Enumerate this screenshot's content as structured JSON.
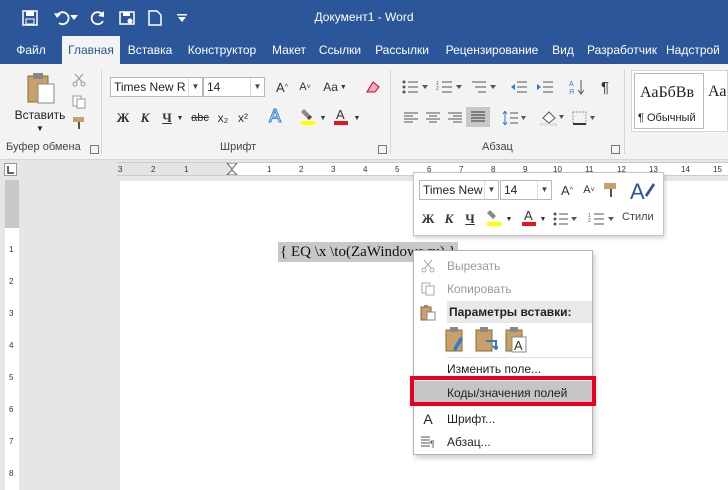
{
  "window": {
    "title": "Документ1 - Word"
  },
  "quick_access": {
    "save_icon": "save-icon",
    "undo_icon": "undo-icon",
    "redo_icon": "repeat-icon",
    "touch_icon": "touch-mode-icon",
    "new_icon": "new-doc-icon",
    "customize_icon": "customize-qat-icon"
  },
  "tabs": [
    "Файл",
    "Главная",
    "Вставка",
    "Конструктор",
    "Макет",
    "Ссылки",
    "Рассылки",
    "Рецензирование",
    "Вид",
    "Разработчик",
    "Надстрой"
  ],
  "active_tab": "Главная",
  "ribbon": {
    "clipboard": {
      "paste_label": "Вставить",
      "group_label": "Буфер обмена"
    },
    "font": {
      "font_name": "Times New R",
      "font_size": "14",
      "grow": "A^",
      "shrink": "A˅",
      "case": "Aa",
      "bold": "Ж",
      "italic": "К",
      "underline": "Ч",
      "strike": "abc",
      "subscript": "x₂",
      "superscript": "x²",
      "group_label": "Шрифт"
    },
    "paragraph": {
      "group_label": "Абзац",
      "pilcrow": "¶"
    },
    "styles": {
      "preview": "АаБбВв",
      "normal_label": "¶ Обычный",
      "preview2": "Аа"
    },
    "colors": {
      "accent": "#2b579a",
      "highlight": "#ffff00",
      "font_color": "#e81123"
    }
  },
  "document": {
    "field_code": "{ EQ \\x \\to(ZaWindows.ru) }"
  },
  "minibar": {
    "font_name": "Times New",
    "font_size": "14",
    "bold": "Ж",
    "italic": "К",
    "underline": "Ч",
    "styles_label": "Стили"
  },
  "context_menu": {
    "cut": "Вырезать",
    "copy": "Копировать",
    "paste_header": "Параметры вставки:",
    "edit_field": "Изменить поле...",
    "toggle_codes": "Коды/значения полей",
    "font": "Шрифт...",
    "paragraph": "Абзац..."
  },
  "highlight_color": "#e8001c"
}
